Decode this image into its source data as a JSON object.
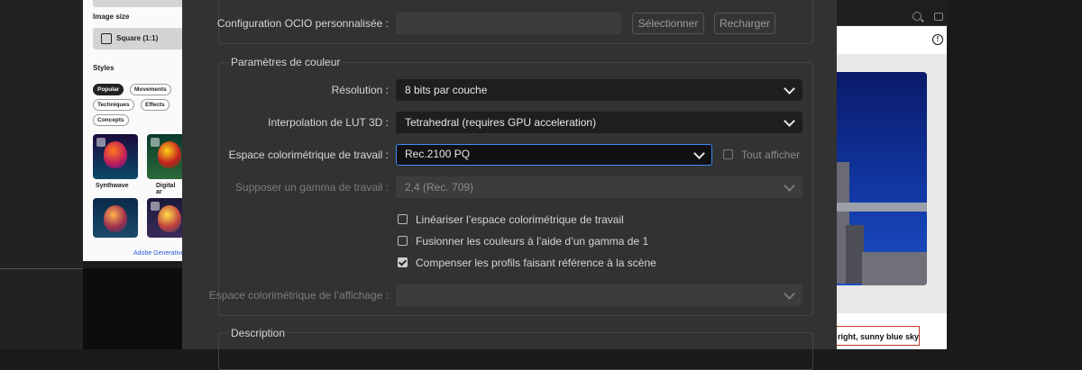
{
  "background_left": {
    "image_size_label": "Image size",
    "aspect_value": "Square (1:1)",
    "styles_label": "Styles",
    "chips": [
      "Popular",
      "Movements",
      "Techniques",
      "Effects",
      "Concepts"
    ],
    "thumbs": [
      {
        "label": "Synthwave"
      },
      {
        "label": "Digital ar"
      }
    ],
    "footer_link": "Adobe Generative"
  },
  "background_right": {
    "prompt_text": "right, sunny blue sky"
  },
  "dialog": {
    "ocio": {
      "label": "Configuration OCIO personnalisée :",
      "value": "",
      "select_button": "Sélectionner",
      "reload_button": "Recharger"
    },
    "color_group": {
      "title": "Paramètres de couleur",
      "resolution": {
        "label": "Résolution :",
        "value": "8 bits par couche"
      },
      "lut": {
        "label": "Interpolation de LUT 3D :",
        "value": "Tetrahedral (requires GPU acceleration)"
      },
      "working_space": {
        "label": "Espace colorimétrique de travail :",
        "value": "Rec.2100 PQ",
        "show_all": "Tout afficher"
      },
      "gamma": {
        "label": "Supposer un gamma de travail :",
        "value": "2,4 (Rec. 709)"
      },
      "checkboxes": [
        {
          "label": "Linéariser l’espace colorimétrique de travail",
          "checked": false
        },
        {
          "label": "Fusionner les couleurs à l’aide d’un gamma de 1",
          "checked": false
        },
        {
          "label": "Compenser les profils faisant référence à la scène",
          "checked": true
        }
      ],
      "display_space": {
        "label": "Espace colorimétrique de l’affichage :",
        "value": ""
      }
    },
    "description_group": {
      "title": "Description"
    }
  },
  "colors": {
    "dialog_bg": "#323232",
    "field_bg": "#1e1e1e",
    "focus_border": "#3a8bff",
    "text": "#d6d6d6",
    "disabled_text": "#7c7c7c"
  }
}
